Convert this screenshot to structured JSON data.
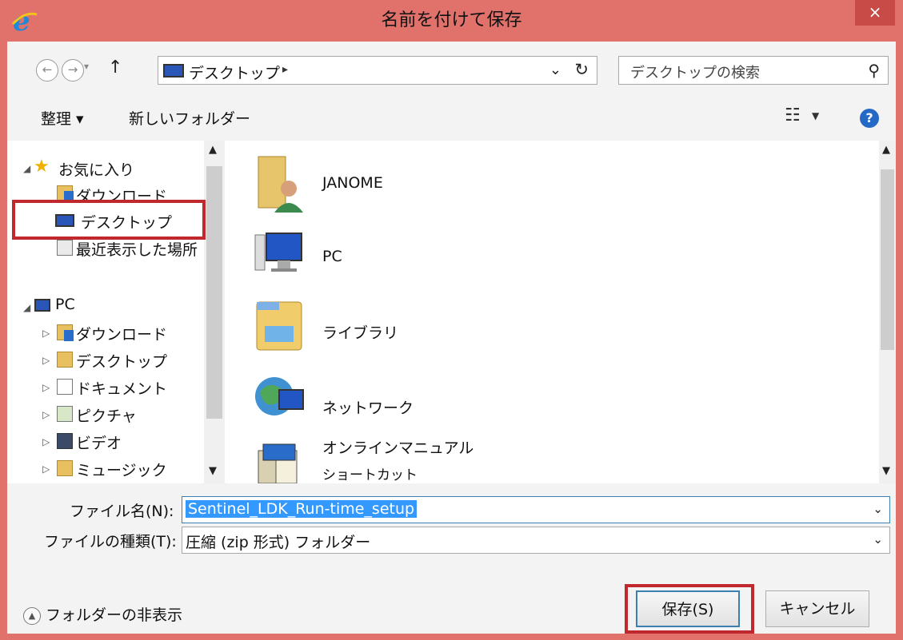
{
  "window": {
    "title": "名前を付けて保存",
    "close_glyph": "×"
  },
  "address": {
    "path": "デスクトップ",
    "separator": "▸",
    "search_placeholder": "デスクトップの検索"
  },
  "toolbar": {
    "organize": "整理 ▾",
    "new_folder": "新しいフォルダー"
  },
  "nav": {
    "favorites": "お気に入り",
    "fav_items": [
      "ダウンロード",
      "デスクトップ",
      "最近表示した場所"
    ],
    "pc": "PC",
    "pc_items": [
      "ダウンロード",
      "デスクトップ",
      "ドキュメント",
      "ピクチャ",
      "ビデオ",
      "ミュージック"
    ]
  },
  "files": [
    {
      "name": "JANOME",
      "icon": "user-folder-icon"
    },
    {
      "name": "PC",
      "icon": "computer-icon"
    },
    {
      "name": "ライブラリ",
      "icon": "library-icon"
    },
    {
      "name": "ネットワーク",
      "icon": "network-icon"
    },
    {
      "name": "オンラインマニュアル",
      "sub": "ショートカット",
      "icon": "manual-icon"
    }
  ],
  "form": {
    "filename_label": "ファイル名(N):",
    "filename_value": "Sentinel_LDK_Run-time_setup",
    "filetype_label": "ファイルの種類(T):",
    "filetype_value": "圧縮 (zip 形式) フォルダー",
    "hide_folders": "フォルダーの非表示",
    "save": "保存(S)",
    "cancel": "キャンセル"
  },
  "colors": {
    "titlebar": "#e0716b",
    "highlight": "#c0282d",
    "selection": "#3399ff"
  }
}
